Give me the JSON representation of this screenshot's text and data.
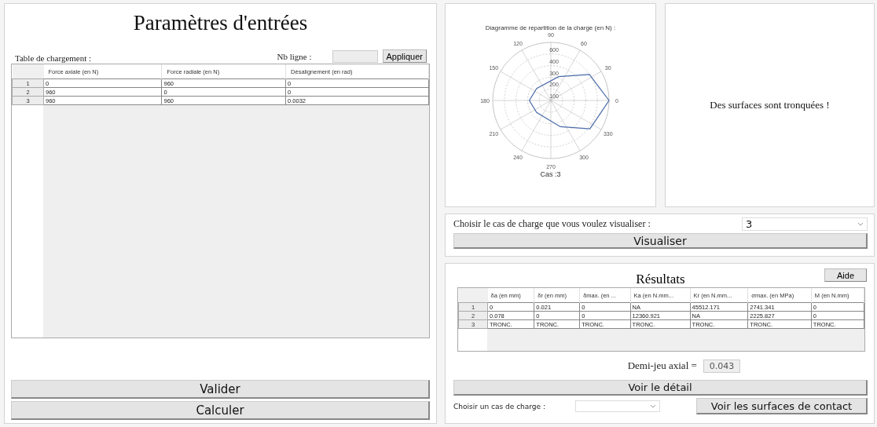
{
  "inputs": {
    "title": "Paramètres d'entrées",
    "table_label": "Table de chargement :",
    "rows_label": "Nb ligne :",
    "apply_button": "Appliquer",
    "table": {
      "columns": [
        "Force axiale (en N)",
        "Force radiale (en N)",
        "Désalignement (en rad)"
      ],
      "rows": [
        {
          "number": "1",
          "cells": [
            "0",
            "960",
            "0"
          ]
        },
        {
          "number": "2",
          "cells": [
            "960",
            "0",
            "0"
          ]
        },
        {
          "number": "3",
          "cells": [
            "960",
            "960",
            "0.0032"
          ]
        }
      ]
    },
    "buttons": [
      "Valider",
      "Calculer"
    ]
  },
  "diagram": {
    "title": "Diagramme de repartition de la charge (en N) :",
    "angle_labels": [
      "0",
      "30",
      "60",
      "90",
      "120",
      "150",
      "180",
      "210",
      "240",
      "270",
      "300",
      "330"
    ],
    "ring_labels": [
      "600",
      "400",
      "300",
      "200",
      "100"
    ],
    "caption": "Cas :3"
  },
  "message": "Des surfaces sont tronquées !",
  "case_picker": {
    "label": "Choisir le cas de charge que vous voulez visualiser :",
    "value": "3",
    "button": "Visualiser"
  },
  "results": {
    "title": "Résultats",
    "help_button": "Aide",
    "table": {
      "columns": [
        "δa (en mm)",
        "δr (en mm)",
        "δmax. (en ...",
        "Ka (en N.mm...",
        "Kr (en N.mm...",
        "σmax. (en MPa)",
        "M (en N.mm)"
      ],
      "rows": [
        {
          "number": "1",
          "cells": [
            "0",
            "0.021",
            "0",
            "NA",
            "45512.171",
            "2741.341",
            "0"
          ]
        },
        {
          "number": "2",
          "cells": [
            "0.078",
            "0",
            "0",
            "12360.921",
            "NA",
            "2225.827",
            "0"
          ]
        },
        {
          "number": "3",
          "cells": [
            "TRONC.",
            "TRONC.",
            "TRONC.",
            "TRONC.",
            "TRONC.",
            "TRONC.",
            "TRONC."
          ]
        }
      ]
    },
    "clearance_label": "Demi-jeu axial =",
    "clearance_value": "0.043",
    "detail_button": "Voir le détail",
    "case_label": "Choisir un cas de charge :",
    "contact_button": "Voir les surfaces de contact"
  }
}
